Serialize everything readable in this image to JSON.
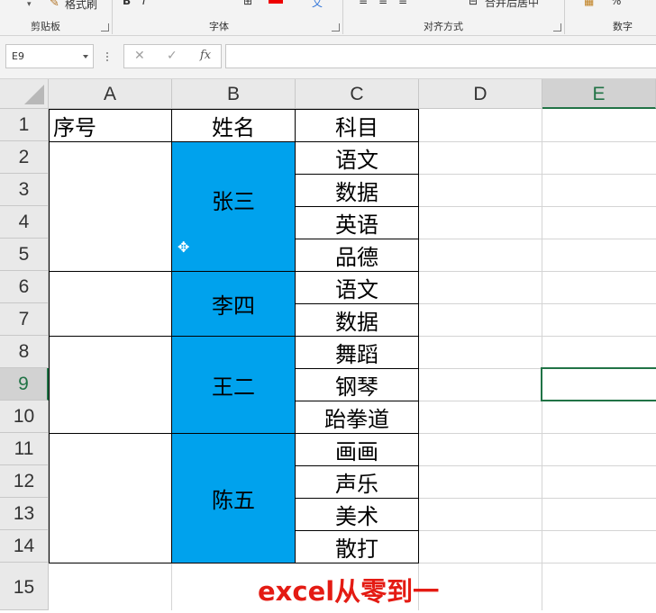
{
  "ribbon": {
    "format_painter_label": "格式刷",
    "groups": [
      "剪贴板",
      "字体",
      "对齐方式",
      "数字"
    ],
    "merge_fragment": "合并后居中"
  },
  "formula_bar": {
    "name_box": "E9",
    "cancel_glyph": "✕",
    "enter_glyph": "✓",
    "fx_label": "fx",
    "formula": ""
  },
  "columns": [
    "A",
    "B",
    "C",
    "D",
    "E"
  ],
  "selected_cell": "E9",
  "rows": [
    "1",
    "2",
    "3",
    "4",
    "5",
    "6",
    "7",
    "8",
    "9",
    "10",
    "11",
    "12",
    "13",
    "14",
    "15"
  ],
  "sheet": {
    "header": {
      "a": "序号",
      "b": "姓名",
      "c": "科目"
    },
    "names": [
      "张三",
      "李四",
      "王二",
      "陈五"
    ],
    "subjects": [
      "语文",
      "数据",
      "英语",
      "品德",
      "语文",
      "数据",
      "舞蹈",
      "钢琴",
      "跆拳道",
      "画画",
      "声乐",
      "美术",
      "散打"
    ]
  },
  "colors": {
    "merged_fill": "#00a2ed",
    "selection": "#217346",
    "watermark": "#e41b13"
  },
  "watermark": "excel从零到一"
}
